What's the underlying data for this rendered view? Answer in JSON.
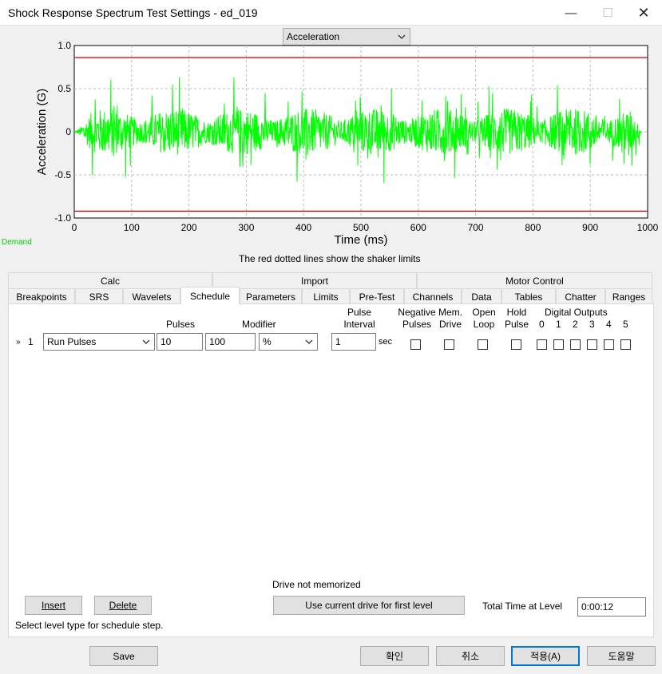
{
  "window": {
    "title": "Shock Response Spectrum Test Settings - ed_019"
  },
  "plot_selector": {
    "value": "Acceleration"
  },
  "chart_data": {
    "type": "line",
    "xlabel": "Time (ms)",
    "ylabel": "Acceleration (G)",
    "xlim": [
      0,
      1000
    ],
    "ylim": [
      -1.0,
      1.0
    ],
    "x_ticks": [
      "0",
      "100",
      "200",
      "300",
      "400",
      "500",
      "600",
      "700",
      "800",
      "900",
      "1000"
    ],
    "y_ticks": [
      "1.0",
      "0.5",
      "0",
      "-0.5",
      "-1.0"
    ],
    "grid": true,
    "series": [
      {
        "color": "#00ff00",
        "signal_start_ms": 0,
        "signal_end_ms": 990,
        "approx_peak_positive": 0.63,
        "approx_peak_negative": -0.73
      }
    ],
    "limit_lines": [
      {
        "value": 0.86,
        "color": "#cc0000"
      },
      {
        "value": -0.92,
        "color": "#cc0000"
      }
    ]
  },
  "demand_label": "Demand",
  "caption": "The red dotted lines show the shaker limits",
  "tabs_row1": [
    "Calc",
    "Import",
    "Motor Control"
  ],
  "tabs_row2": [
    "Breakpoints",
    "SRS",
    "Wavelets",
    "Schedule",
    "Parameters",
    "Limits",
    "Pre-Test",
    "Channels",
    "Data",
    "Tables",
    "Chatter",
    "Ranges"
  ],
  "schedule": {
    "headers": {
      "pulses": "Pulses",
      "modifier": "Modifier",
      "pulse_interval_1": "Pulse",
      "pulse_interval_2": "Interval",
      "negative_1": "Negative",
      "negative_2": "Pulses",
      "mem_1": "Mem.",
      "mem_2": "Drive",
      "open_1": "Open",
      "open_2": "Loop",
      "hold_1": "Hold",
      "hold_2": "Pulse",
      "digital_outputs": "Digital Outputs",
      "digital_indices": [
        "0",
        "1",
        "2",
        "3",
        "4",
        "5"
      ]
    },
    "row": {
      "marker": "»",
      "index": "1",
      "level_type": "Run Pulses",
      "pulses": "10",
      "modifier_value": "100",
      "modifier_unit": "%",
      "interval": "1",
      "interval_unit": "sec"
    },
    "drive_status": "Drive not memorized",
    "insert_label": "Insert",
    "delete_label": "Delete",
    "use_drive_label": "Use current drive for first level",
    "total_time_label": "Total Time at Level",
    "total_time_value": "0:00:12",
    "hint": "Select level type for schedule step."
  },
  "footer": {
    "save": "Save",
    "ok": "확인",
    "cancel": "취소",
    "apply": "적용(A)",
    "help": "도움말"
  }
}
